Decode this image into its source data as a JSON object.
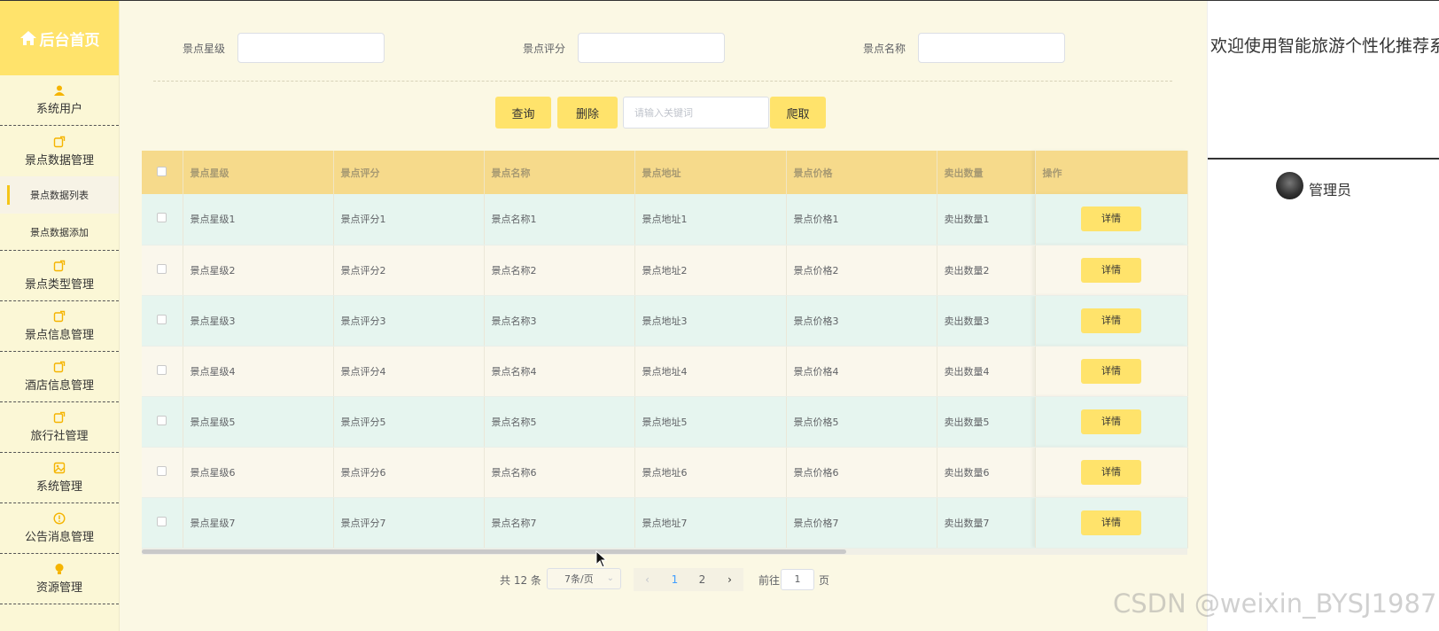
{
  "sidebar": {
    "home_label": "后台首页",
    "items": [
      {
        "label": "系统用户",
        "icon": "user-icon"
      },
      {
        "label": "景点数据管理",
        "icon": "edit-icon"
      },
      {
        "label": "景点类型管理",
        "icon": "edit-icon"
      },
      {
        "label": "景点信息管理",
        "icon": "edit-icon"
      },
      {
        "label": "酒店信息管理",
        "icon": "edit-icon"
      },
      {
        "label": "旅行社管理",
        "icon": "edit-icon"
      },
      {
        "label": "系统管理",
        "icon": "image-icon"
      },
      {
        "label": "公告消息管理",
        "icon": "info-icon"
      },
      {
        "label": "资源管理",
        "icon": "bulb-icon"
      }
    ],
    "subitems": [
      {
        "label": "景点数据列表",
        "active": true
      },
      {
        "label": "景点数据添加",
        "active": false
      }
    ]
  },
  "search": {
    "field1_label": "景点星级",
    "field2_label": "景点评分",
    "field3_label": "景点名称",
    "query_button": "查询",
    "delete_button": "删除",
    "keyword_placeholder": "请输入关键词",
    "crawl_button": "爬取"
  },
  "table": {
    "headers": [
      "景点星级",
      "景点评分",
      "景点名称",
      "景点地址",
      "景点价格",
      "卖出数量",
      "操作"
    ],
    "detail_label": "详情",
    "rows": [
      [
        "景点星级1",
        "景点评分1",
        "景点名称1",
        "景点地址1",
        "景点价格1",
        "卖出数量1"
      ],
      [
        "景点星级2",
        "景点评分2",
        "景点名称2",
        "景点地址2",
        "景点价格2",
        "卖出数量2"
      ],
      [
        "景点星级3",
        "景点评分3",
        "景点名称3",
        "景点地址3",
        "景点价格3",
        "卖出数量3"
      ],
      [
        "景点星级4",
        "景点评分4",
        "景点名称4",
        "景点地址4",
        "景点价格4",
        "卖出数量4"
      ],
      [
        "景点星级5",
        "景点评分5",
        "景点名称5",
        "景点地址5",
        "景点价格5",
        "卖出数量5"
      ],
      [
        "景点星级6",
        "景点评分6",
        "景点名称6",
        "景点地址6",
        "景点价格6",
        "卖出数量6"
      ],
      [
        "景点星级7",
        "景点评分7",
        "景点名称7",
        "景点地址7",
        "景点价格7",
        "卖出数量7"
      ]
    ]
  },
  "pagination": {
    "total": "共 12 条",
    "page_size": "7条/页",
    "pages": [
      "1",
      "2"
    ],
    "current_page": "1",
    "goto_prefix": "前往",
    "goto_value": "1",
    "goto_suffix": "页"
  },
  "right_panel": {
    "welcome": "欢迎使用智能旅游个性化推荐系统",
    "username": "管理员"
  },
  "watermark": "CSDN @weixin_BYSJ1987",
  "colors": {
    "accent_yellow": "#ffe36b",
    "header_bg": "#f6da8b",
    "row_odd": "#e6f5ef",
    "row_even": "#faf7ec",
    "page_bg": "#fbf8e4",
    "current_page": "#409eff"
  }
}
